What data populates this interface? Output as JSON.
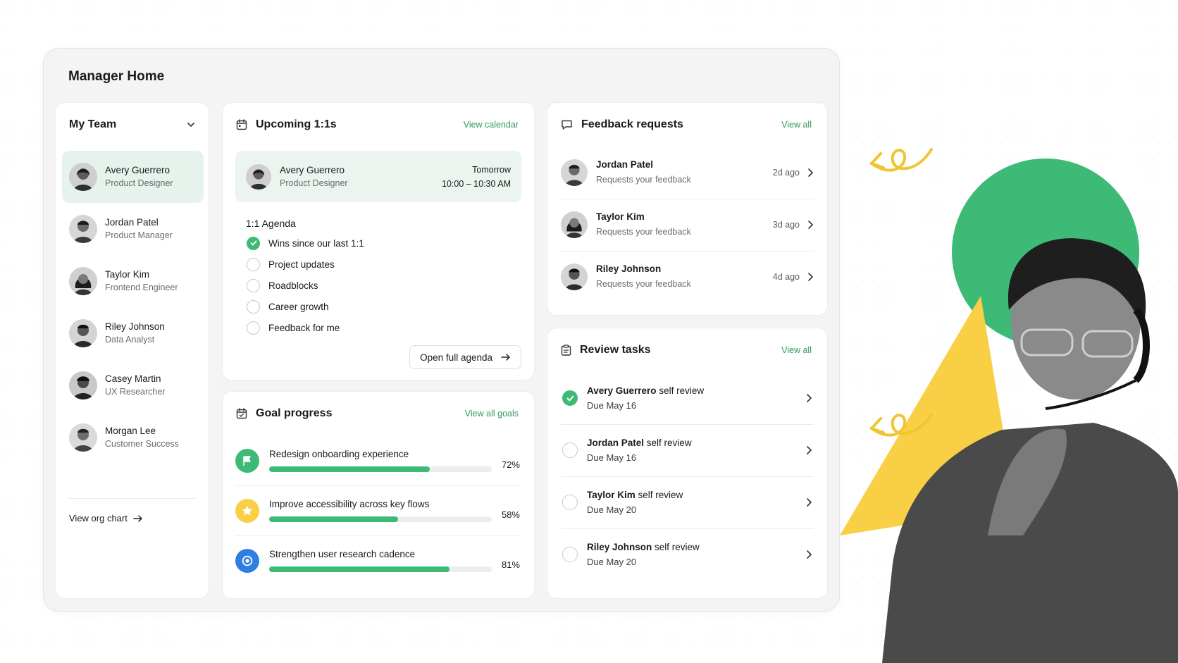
{
  "page": {
    "title": "Manager Home"
  },
  "team": {
    "title": "My Team",
    "members": [
      {
        "name": "Avery Guerrero",
        "role": "Product Designer",
        "active": true
      },
      {
        "name": "Jordan Patel",
        "role": "Product Manager"
      },
      {
        "name": "Taylor Kim",
        "role": "Frontend Engineer"
      },
      {
        "name": "Riley Johnson",
        "role": "Data Analyst"
      },
      {
        "name": "Casey Martin",
        "role": "UX Researcher"
      },
      {
        "name": "Morgan Lee",
        "role": "Customer Success"
      }
    ],
    "org_link": "View org chart"
  },
  "upcoming": {
    "title": "Upcoming 1:1s",
    "link": "View calendar",
    "meeting": {
      "name": "Avery Guerrero",
      "role": "Product Designer",
      "day": "Tomorrow",
      "time": "10:00 – 10:30 AM"
    },
    "agenda_title": "1:1 Agenda",
    "agenda": [
      {
        "label": "Wins since our last 1:1",
        "done": true
      },
      {
        "label": "Project updates",
        "done": false
      },
      {
        "label": "Roadblocks",
        "done": false
      },
      {
        "label": "Career growth",
        "done": false
      },
      {
        "label": "Feedback for me",
        "done": false
      }
    ],
    "open_button": "Open full agenda"
  },
  "goals": {
    "title": "Goal progress",
    "link": "View all goals",
    "items": [
      {
        "label": "Redesign onboarding experience",
        "percent": "72%",
        "progress": 0.72,
        "icon": "flag-icon",
        "color": "#3dba76"
      },
      {
        "label": "Improve accessibility across key flows",
        "percent": "58%",
        "progress": 0.58,
        "icon": "star-icon",
        "color": "#f9cf46"
      },
      {
        "label": "Strengthen user research cadence",
        "percent": "81%",
        "progress": 0.81,
        "icon": "target-icon",
        "color": "#2f7fe0"
      }
    ]
  },
  "feedback": {
    "title": "Feedback requests",
    "link": "View all",
    "items": [
      {
        "name": "Jordan Patel",
        "sub": "Requests your feedback",
        "time": "2d ago"
      },
      {
        "name": "Taylor Kim",
        "sub": "Requests your feedback",
        "time": "3d ago"
      },
      {
        "name": "Riley Johnson",
        "sub": "Requests your feedback",
        "time": "4d ago"
      }
    ]
  },
  "review": {
    "title": "Review tasks",
    "link": "View all",
    "suffix": "self review",
    "items": [
      {
        "name": "Avery Guerrero",
        "due": "Due May 16",
        "done": true
      },
      {
        "name": "Jordan Patel",
        "due": "Due May 16",
        "done": false
      },
      {
        "name": "Taylor Kim",
        "due": "Due May 20",
        "done": false
      },
      {
        "name": "Riley Johnson",
        "due": "Due May 20",
        "done": false
      }
    ]
  },
  "colors": {
    "accent": "#3dba76",
    "accent_bg": "#e6f3ec",
    "yellow": "#f9cf46",
    "link": "#2f9a5e"
  }
}
